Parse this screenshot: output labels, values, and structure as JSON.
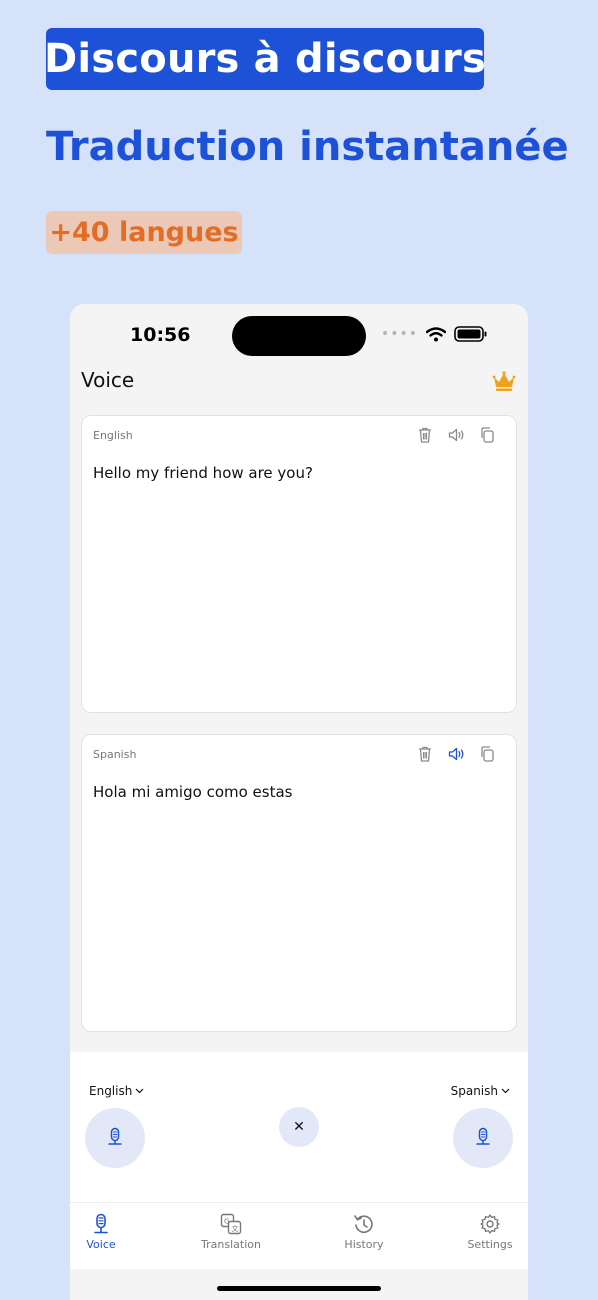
{
  "promo": {
    "headline": "Discours à discours",
    "subtitle": "Traduction instantanée",
    "languages_badge": "+40 langues"
  },
  "status_bar": {
    "time": "10:56"
  },
  "app": {
    "title": "Voice",
    "accent_color": "#1d52d8",
    "premium_icon": "crown-icon"
  },
  "source_card": {
    "language": "English",
    "text": "Hello my friend how are you?",
    "actions": [
      "trash-icon",
      "speaker-icon",
      "copy-icon"
    ]
  },
  "target_card": {
    "language": "Spanish",
    "text": "Hola mi amigo como estas",
    "actions": [
      "trash-icon",
      "speaker-icon",
      "copy-icon"
    ]
  },
  "controls": {
    "source_language": "English",
    "target_language": "Spanish",
    "swap_glyph": "✕"
  },
  "tab_bar": {
    "tabs": [
      {
        "label": "Voice",
        "icon": "microphone-icon",
        "active": true
      },
      {
        "label": "Translation",
        "icon": "translation-icon",
        "active": false
      },
      {
        "label": "History",
        "icon": "history-icon",
        "active": false
      },
      {
        "label": "Settings",
        "icon": "gear-icon",
        "active": false
      }
    ]
  }
}
